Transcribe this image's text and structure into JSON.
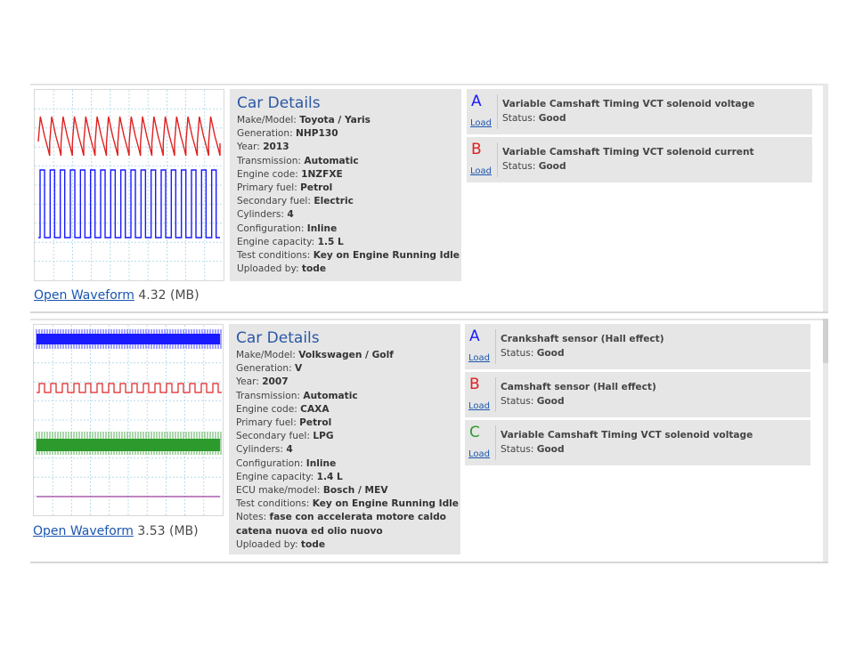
{
  "colors": {
    "channel_a": "#1a1aff",
    "channel_b": "#e02020",
    "channel_c": "#2c9a2c",
    "link": "#1a56b0",
    "heading": "#2c57a5"
  },
  "listings": [
    {
      "open_waveform_label": "Open Waveform",
      "file_size": "4.32 (MB)",
      "details_title": "Car Details",
      "fields": [
        {
          "label": "Make/Model:",
          "value": "Toyota / Yaris"
        },
        {
          "label": "Generation:",
          "value": "NHP130"
        },
        {
          "label": "Year:",
          "value": "2013"
        },
        {
          "label": "Transmission:",
          "value": "Automatic"
        },
        {
          "label": "Engine code:",
          "value": "1NZFXE"
        },
        {
          "label": "Primary fuel:",
          "value": "Petrol"
        },
        {
          "label": "Secondary fuel:",
          "value": "Electric"
        },
        {
          "label": "Cylinders:",
          "value": "4"
        },
        {
          "label": "Configuration:",
          "value": "Inline"
        },
        {
          "label": "Engine capacity:",
          "value": "1.5 L"
        },
        {
          "label": "Test conditions:",
          "value": "Key on Engine Running Idle"
        },
        {
          "label": "Uploaded by:",
          "value": "tode"
        }
      ],
      "channels": [
        {
          "letter": "A",
          "color": "#1a1aff",
          "load_label": "Load",
          "title": "Variable Camshaft Timing VCT solenoid voltage",
          "status_label": "Status:",
          "status_value": "Good"
        },
        {
          "letter": "B",
          "color": "#e02020",
          "load_label": "Load",
          "title": "Variable Camshaft Timing VCT solenoid current",
          "status_label": "Status:",
          "status_value": "Good"
        }
      ]
    },
    {
      "open_waveform_label": "Open Waveform",
      "file_size": "3.53 (MB)",
      "details_title": "Car Details",
      "fields": [
        {
          "label": "Make/Model:",
          "value": "Volkswagen / Golf"
        },
        {
          "label": "Generation:",
          "value": "V"
        },
        {
          "label": "Year:",
          "value": "2007"
        },
        {
          "label": "Transmission:",
          "value": "Automatic"
        },
        {
          "label": "Engine code:",
          "value": "CAXA"
        },
        {
          "label": "Primary fuel:",
          "value": "Petrol"
        },
        {
          "label": "Secondary fuel:",
          "value": "LPG"
        },
        {
          "label": "Cylinders:",
          "value": "4"
        },
        {
          "label": "Configuration:",
          "value": "Inline"
        },
        {
          "label": "Engine capacity:",
          "value": "1.4 L"
        },
        {
          "label": "ECU make/model:",
          "value": "Bosch / MEV"
        },
        {
          "label": "Test conditions:",
          "value": "Key on Engine Running Idle"
        },
        {
          "label": "Notes:",
          "value": "fase con accelerata motore caldo catena nuova ed olio nuovo"
        },
        {
          "label": "Uploaded by:",
          "value": "tode"
        }
      ],
      "channels": [
        {
          "letter": "A",
          "color": "#1a1aff",
          "load_label": "Load",
          "title": "Crankshaft sensor (Hall effect)",
          "status_label": "Status:",
          "status_value": "Good"
        },
        {
          "letter": "B",
          "color": "#e02020",
          "load_label": "Load",
          "title": "Camshaft sensor (Hall effect)",
          "status_label": "Status:",
          "status_value": "Good"
        },
        {
          "letter": "C",
          "color": "#2c9a2c",
          "load_label": "Load",
          "title": "Variable Camshaft Timing VCT solenoid voltage",
          "status_label": "Status:",
          "status_value": "Good"
        }
      ]
    }
  ]
}
